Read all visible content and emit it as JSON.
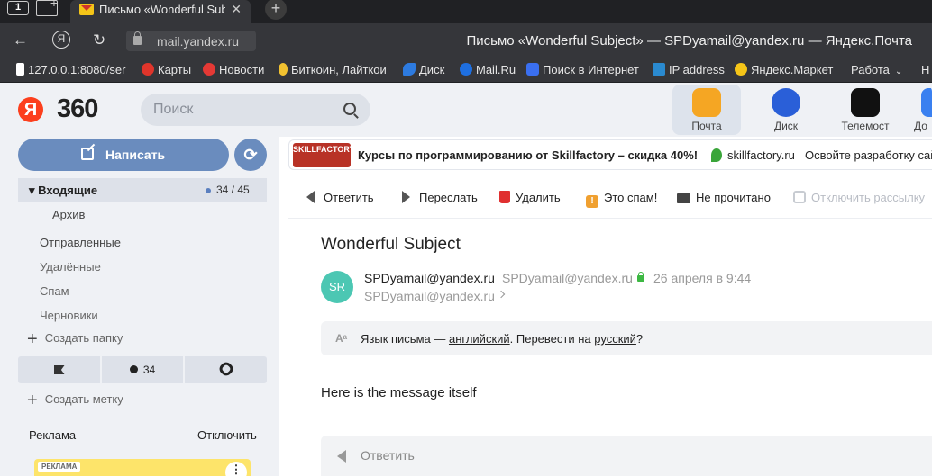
{
  "browser": {
    "tab_count": "1",
    "active_tab_title": "Письмо «Wonderful Subject» — SPDyamail@yandex.ru — Яндекс.Почта",
    "url": "mail.yandex.ru",
    "window_title": "Письмо «Wonderful Subject» — SPDyamail@yandex.ru — Яндекс.Почта",
    "bookmarks": [
      {
        "label": "127.0.0.1:8080/ser",
        "icon": "local-icon",
        "color": "#888888"
      },
      {
        "label": "Карты",
        "icon": "maps-pin-icon",
        "color": "#e0352b"
      },
      {
        "label": "Новости",
        "icon": "news-icon",
        "color": "#e53935"
      },
      {
        "label": "Биткоин, Лайткои",
        "icon": "coin-icon",
        "color": "#f2c230"
      },
      {
        "label": "Диск",
        "icon": "disk-icon",
        "color": "#2d7be0"
      },
      {
        "label": "Mail.Ru",
        "icon": "mailru-icon",
        "color": "#1e6fe0"
      },
      {
        "label": "Поиск в Интернет",
        "icon": "search-engine-icon",
        "color": "#3a6ff0"
      },
      {
        "label": "IP address",
        "icon": "ip-icon",
        "color": "#2a8ad0"
      },
      {
        "label": "Яндекс.Маркет",
        "icon": "market-icon",
        "color": "#f5c518"
      },
      {
        "label": "Работа",
        "icon": "folder-icon",
        "color": "#e6e6e6"
      },
      {
        "label": "Н",
        "icon": "",
        "color": "#e6e6e6"
      }
    ]
  },
  "header": {
    "logo_letter": "Я",
    "logo_text": "360",
    "search_placeholder": "Поиск",
    "services": [
      {
        "label": "Почта",
        "icon": "mail-service-icon",
        "color": "#f5a623"
      },
      {
        "label": "Диск",
        "icon": "disk-service-icon",
        "color": "#2a5fd8"
      },
      {
        "label": "Телемост",
        "icon": "telemost-service-icon",
        "color": "#111111"
      },
      {
        "label": "До",
        "icon": "docs-service-icon",
        "color": "#3a80f0"
      }
    ]
  },
  "sidebar": {
    "compose_label": "Написать",
    "folders": [
      {
        "label": "▾ Входящие",
        "count": "34 / 45"
      },
      {
        "label": "Архив"
      },
      {
        "label": "Отправленные"
      },
      {
        "label": "Удалённые"
      },
      {
        "label": "Спам"
      },
      {
        "label": "Черновики"
      }
    ],
    "create_folder": "Создать папку",
    "filters": {
      "unread_count": "34"
    },
    "create_label": "Создать метку",
    "ad_label": "Реклама",
    "ad_disable": "Отключить",
    "ad_tag": "РЕКЛАМА"
  },
  "promo": {
    "image_text": "SKILLFACTORY",
    "title": "Курсы по программированию от Skillfactory – скидка 40%!",
    "site": "skillfactory.ru",
    "tail": "Освойте разработку сай"
  },
  "toolbar": {
    "reply": "Ответить",
    "forward": "Переслать",
    "delete": "Удалить",
    "spam": "Это спам!",
    "unread": "Не прочитано",
    "unsubscribe": "Отключить рассылку"
  },
  "message": {
    "subject": "Wonderful Subject",
    "avatar_initials": "SR",
    "sender_name": "SPDyamail@yandex.ru",
    "sender_email": "SPDyamail@yandex.ru",
    "date": "26 апреля в 9:44",
    "recipient": "SPDyamail@yandex.ru",
    "translate_prefix": "Язык письма — ",
    "translate_lang": "английский",
    "translate_mid": ". Перевести на ",
    "translate_target": "русский",
    "translate_suffix": "?",
    "body": "Here is the message itself",
    "reply_label": "Ответить"
  }
}
